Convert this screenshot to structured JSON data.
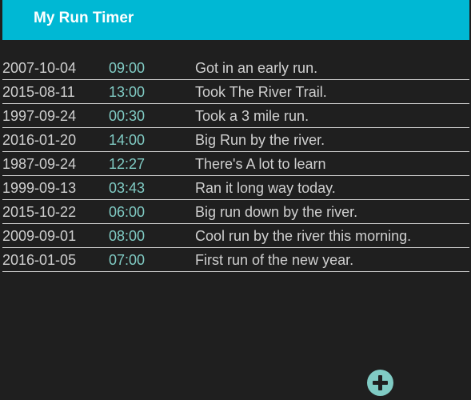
{
  "app": {
    "title": "My Run Timer"
  },
  "runs": [
    {
      "date": "2007-10-04",
      "time": "09:00",
      "note": "Got in an early run."
    },
    {
      "date": "2015-08-11",
      "time": "13:00",
      "note": "Took The River Trail."
    },
    {
      "date": "1997-09-24",
      "time": "00:30",
      "note": "Took a 3 mile run."
    },
    {
      "date": "2016-01-20",
      "time": "14:00",
      "note": "Big Run by the river."
    },
    {
      "date": "1987-09-24",
      "time": "12:27",
      "note": "There's A lot to learn"
    },
    {
      "date": "1999-09-13",
      "time": "03:43",
      "note": "Ran it long way today."
    },
    {
      "date": "2015-10-22",
      "time": "06:00",
      "note": "Big run down by the river."
    },
    {
      "date": "2009-09-01",
      "time": "08:00",
      "note": "Cool run by the river this morning."
    },
    {
      "date": "2016-01-05",
      "time": "07:00",
      "note": "First run of the new year."
    }
  ],
  "fab": {
    "icon": "plus-icon"
  },
  "colors": {
    "toolbar": "#00b8d4",
    "background": "#1f1f1f",
    "accent": "#80cbc4",
    "text": "#cfcfcf"
  }
}
